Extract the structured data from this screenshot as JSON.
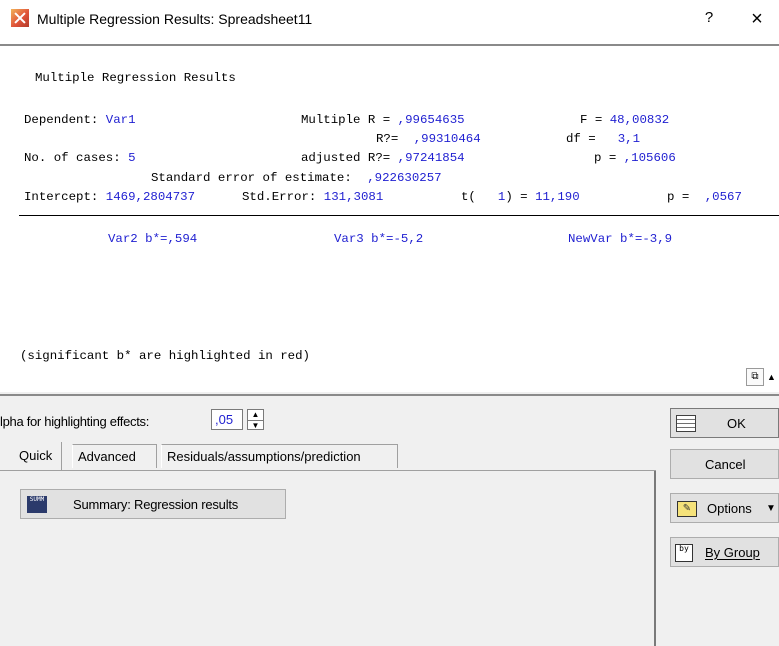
{
  "window": {
    "title": "Multiple Regression Results: Spreadsheet11",
    "help_label": "?",
    "close_label": "×"
  },
  "results": {
    "heading": "Multiple Regression Results",
    "dependent_label": "Dependent: ",
    "dependent_value": "Var1",
    "multiple_r_label": "Multiple R = ",
    "multiple_r_value": ",99654635",
    "f_label": "F = ",
    "f_value": "48,00832",
    "r2_label": "R?= ",
    "r2_value": ",99310464",
    "df_label": "df =",
    "df_value": "3,1",
    "cases_label": "No. of cases: ",
    "cases_value": "5",
    "adj_r2_label": "adjusted R?= ",
    "adj_r2_value": ",97241854",
    "p_label": "p = ",
    "p_value": ",105606",
    "se_label": "Standard error of estimate: ",
    "se_value": ",922630257",
    "intercept_label": "Intercept: ",
    "intercept_value": "1469,2804737",
    "std_error_label": "Std.Error: ",
    "std_error_value": "131,3081",
    "t_label": "t(",
    "t_df_value": "1",
    "t_eq": ") = ",
    "t_value": "11,190",
    "p2_label": "p = ",
    "p2_value": ",0567",
    "coef1": "Var2 b*=,594",
    "coef2": "Var3 b*=-5,2",
    "coef3": "NewVar b*=-3,9",
    "note": "(significant b* are highlighted in red)"
  },
  "controls": {
    "alpha_label": "lpha for highlighting effects:",
    "alpha_value": ",05",
    "tabs": [
      "Quick",
      "Advanced",
      "Residuals/assumptions/prediction"
    ],
    "summary_button": "Summary:  Regression results",
    "summary_icon_text": "SUMM",
    "ok": "OK",
    "cancel": "Cancel",
    "options": "Options",
    "by_group": "By Group",
    "by_group_icon_text": "by"
  },
  "colors": {
    "value_blue": "#1f1fd1",
    "panel_bg": "#f0f0f0"
  }
}
